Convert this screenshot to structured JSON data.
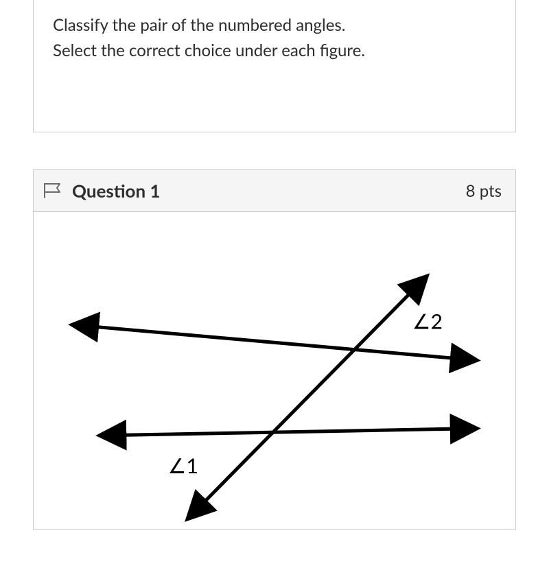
{
  "instructions": {
    "line1": "Classify the pair of the numbered angles.",
    "line2": "Select the correct choice under each figure."
  },
  "question": {
    "title": "Question 1",
    "points": "8 pts",
    "figure": {
      "angle1_label": "∠1",
      "angle2_label": "∠2"
    }
  }
}
